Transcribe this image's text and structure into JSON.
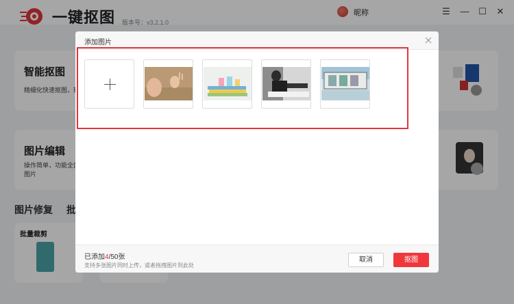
{
  "app": {
    "name": "一键抠图",
    "version": "版本号：v3.2.1.0",
    "nickname": "昵称",
    "brand_color": "#e0353b"
  },
  "window_controls": {
    "menu_icon": "☰",
    "minimize_icon": "—",
    "maximize_icon": "☐",
    "close_icon": "✕"
  },
  "background_cards": {
    "smart_cutout": {
      "title": "智能抠图",
      "desc": "精细化快速抠图，轻"
    },
    "image_edit": {
      "title": "图片编辑",
      "desc_line1": "操作简单，功能全面",
      "desc_line2": "图片"
    },
    "section_repair": "图片修复",
    "section_batch_initial": "批",
    "batch_crop": {
      "title": "批量裁剪"
    }
  },
  "dialog": {
    "title": "添加图片",
    "thumbnails": [
      "child-sand-photo",
      "books-cups-photo",
      "woman-reading-photo",
      "film-strip-photo"
    ],
    "footer": {
      "count_prefix": "已添加",
      "count_current": "4",
      "count_suffix": "/50张",
      "hint": "支持多张图片同时上传，或者拖拽图片到此处",
      "cancel_label": "取消",
      "cutout_label": "抠图"
    }
  }
}
